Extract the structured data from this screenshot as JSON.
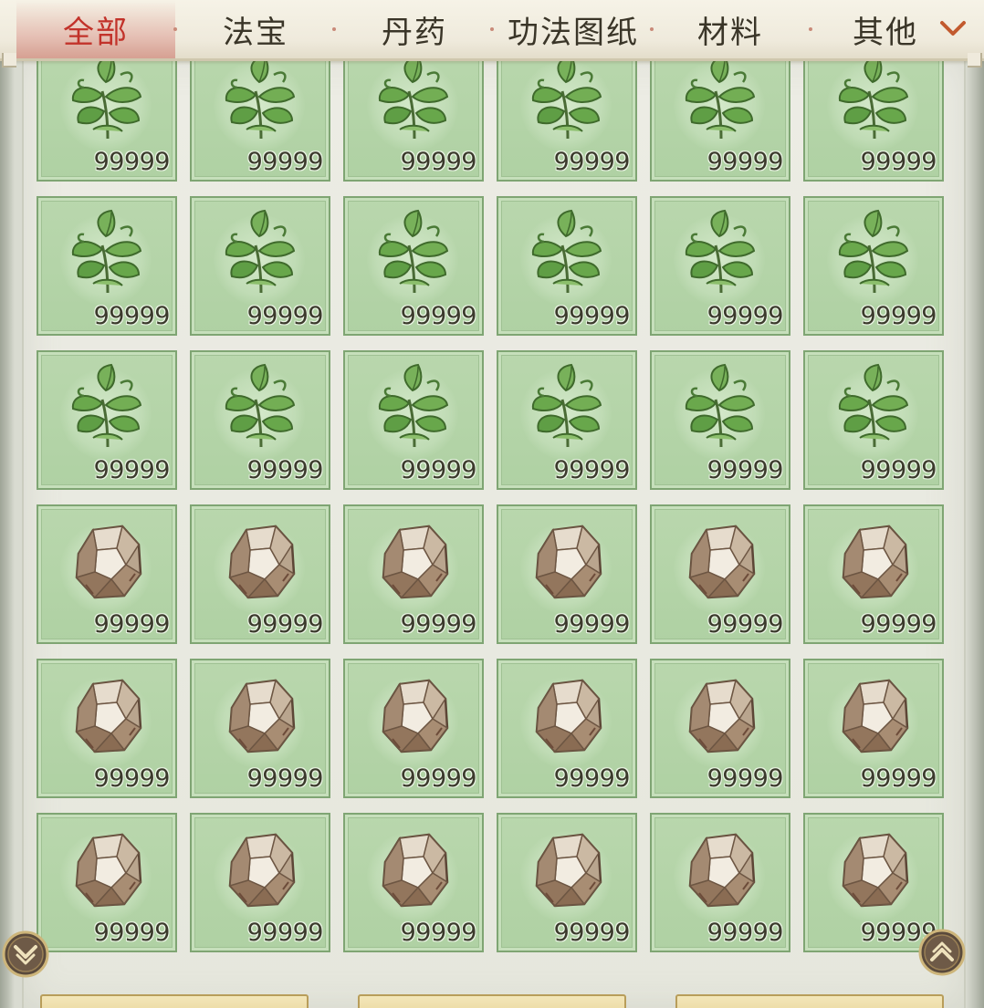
{
  "tabs": [
    {
      "label": "全部",
      "active": true
    },
    {
      "label": "法宝",
      "active": false
    },
    {
      "label": "丹药",
      "active": false
    },
    {
      "label": "功法图纸",
      "active": false
    },
    {
      "label": "材料",
      "active": false
    },
    {
      "label": "其他",
      "active": false
    }
  ],
  "dropdown_icon": "chevron-down-icon",
  "grid": {
    "columns": 6,
    "rows": [
      {
        "item": "herb",
        "count": "99999"
      },
      {
        "item": "herb",
        "count": "99999"
      },
      {
        "item": "herb",
        "count": "99999"
      },
      {
        "item": "ore",
        "count": "99999"
      },
      {
        "item": "ore",
        "count": "99999"
      },
      {
        "item": "ore",
        "count": "99999"
      }
    ]
  },
  "colors": {
    "active_tab": "#c2322a",
    "cell_bg": "#b4d4a8",
    "cell_border": "#7fa573"
  },
  "scroll": {
    "down_icon": "scroll-down-icon",
    "up_icon": "scroll-up-icon"
  },
  "bottom_buttons": 3
}
